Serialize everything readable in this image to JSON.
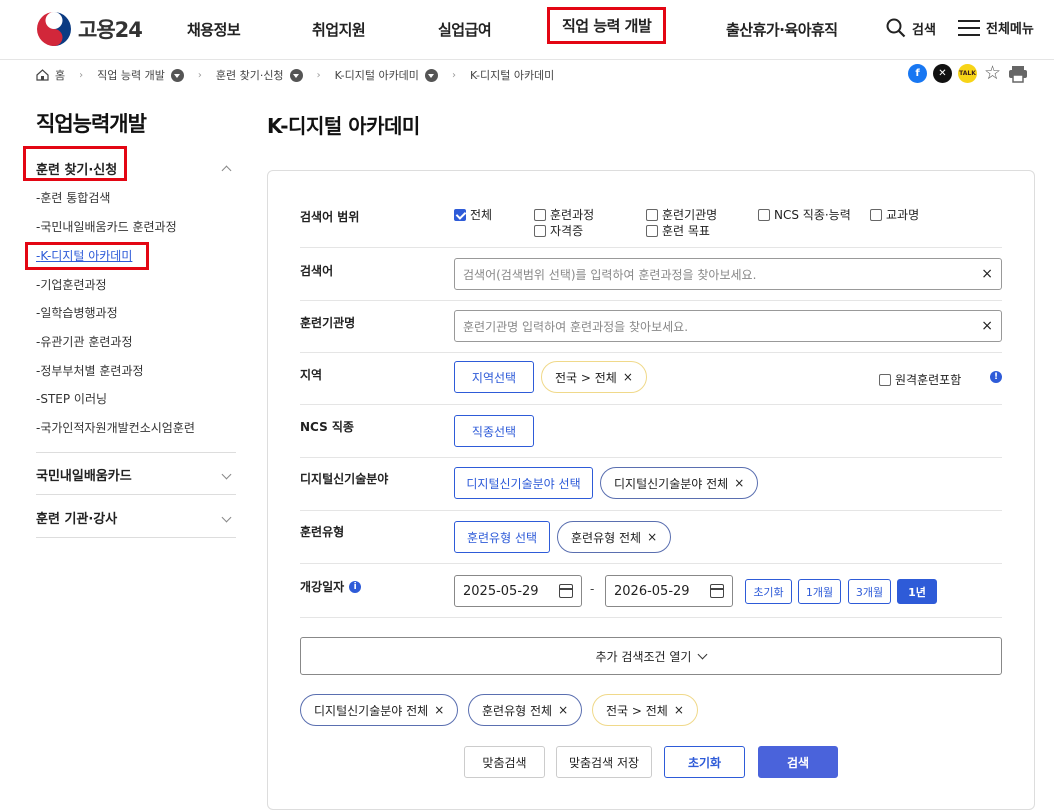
{
  "header": {
    "logo_text": "고용24",
    "nav": [
      "채용정보",
      "취업지원",
      "실업급여",
      "직업 능력 개발",
      "출산휴가·육아휴직"
    ],
    "search_label": "검색",
    "menu_label": "전체메뉴"
  },
  "breadcrumb": [
    "홈",
    "직업 능력 개발",
    "훈련 찾기·신청",
    "K-디지털 아카데미",
    "K-디지털 아카데미"
  ],
  "share_icons": [
    "facebook-icon",
    "x-icon",
    "kakao-icon",
    "star-icon",
    "print-icon"
  ],
  "kakao_label": "TALK",
  "sidebar": {
    "title": "직업능력개발",
    "group1": {
      "label": "훈련 찾기·신청",
      "items": [
        "훈련 통합검색",
        "국민내일배움카드 훈련과정",
        "K-디지털 아카데미",
        "기업훈련과정",
        "일학습병행과정",
        "유관기관 훈련과정",
        "정부부처별 훈련과정",
        "STEP 이러닝",
        "국가인적자원개발컨소시엄훈련"
      ]
    },
    "group2": {
      "label": "국민내일배움카드"
    },
    "group3": {
      "label": "훈련 기관·강사"
    }
  },
  "main": {
    "title": "K-디지털 아카데미",
    "rows": {
      "scope": "검색어 범위",
      "keyword": "검색어",
      "institution": "훈련기관명",
      "region": "지역",
      "ncs": "NCS 직종",
      "digital": "디지털신기술분야",
      "type": "훈련유형",
      "date": "개강일자"
    },
    "scope_options": [
      {
        "label": "전체",
        "checked": true
      },
      {
        "label": "훈련과정",
        "checked": false
      },
      {
        "label": "훈련기관명",
        "checked": false
      },
      {
        "label": "NCS 직종·능력",
        "checked": false
      },
      {
        "label": "교과명",
        "checked": false
      },
      {
        "label": "자격증",
        "checked": false
      },
      {
        "label": "훈련 목표",
        "checked": false
      }
    ],
    "keyword_placeholder": "검색어(검색범위 선택)를 입력하여 훈련과정을 찾아보세요.",
    "institution_placeholder": "훈련기관명 입력하여 훈련과정을 찾아보세요.",
    "region_btn": "지역선택",
    "region_chip": "전국 > 전체",
    "remote_label": "원격훈련포함",
    "ncs_btn": "직종선택",
    "digital_btn": "디지털신기술분야 선택",
    "digital_chip": "디지털신기술분야 전체",
    "type_btn": "훈련유형 선택",
    "type_chip": "훈련유형 전체",
    "date_start": "2025-05-29",
    "date_sep": "-",
    "date_end": "2026-05-29",
    "periods": [
      "초기화",
      "1개월",
      "3개월",
      "1년"
    ],
    "active_period": "1년",
    "more_label": "추가 검색조건 열기",
    "summary_chips": [
      "디지털신기술분야 전체",
      "훈련유형 전체",
      "전국 > 전체"
    ],
    "actions": [
      "맞춤검색",
      "맞춤검색 저장",
      "초기화",
      "검색"
    ]
  },
  "colors": {
    "accent": "#2e5bd8",
    "highlight": "#e30613",
    "search_btn": "#4a63db"
  }
}
